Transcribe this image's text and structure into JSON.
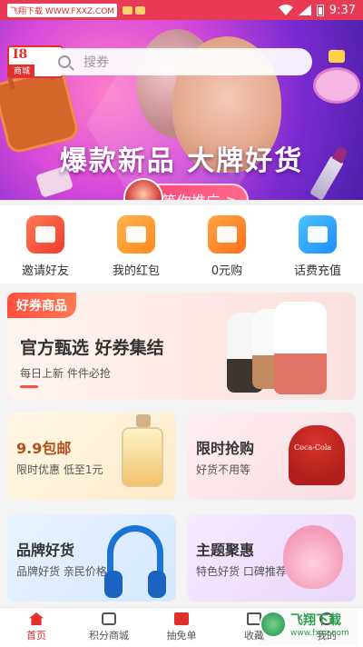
{
  "status_bar": {
    "watermark": "飞翔下载 WWW.FXXZ.COM",
    "time": "9:37"
  },
  "header": {
    "logo_main": "I8",
    "logo_sub": "商城",
    "search_placeholder": "搜券"
  },
  "banner": {
    "headline": "爆款新品 大牌好货",
    "cta_label": "等你推广",
    "cta_arrow": ">"
  },
  "quick_actions": [
    {
      "label": "邀请好友",
      "icon": "invite-icon",
      "color": "#f03a2f"
    },
    {
      "label": "我的红包",
      "icon": "gift-icon",
      "color": "#ff8a1e"
    },
    {
      "label": "0元购",
      "icon": "store-icon",
      "color": "#ff6f1e"
    },
    {
      "label": "话费充值",
      "icon": "phone-topup-icon",
      "color": "#1e8dff"
    }
  ],
  "coupon_section": {
    "tag": "好券商品",
    "title": "官方甄选 好券集结",
    "subtitle": "每日上新 件件必抢"
  },
  "promo_cards": [
    {
      "title": "9.9包邮",
      "subtitle": "限时优惠 低至1元"
    },
    {
      "title": "限时抢购",
      "subtitle": "好货不用等"
    },
    {
      "title": "品牌好货",
      "subtitle": "品牌好货 亲民价格"
    },
    {
      "title": "主题聚惠",
      "subtitle": "特色好货 口碑推荐"
    }
  ],
  "bottom_nav": [
    {
      "label": "首页",
      "icon": "home-icon",
      "active": true
    },
    {
      "label": "积分商城",
      "icon": "store-icon",
      "active": false
    },
    {
      "label": "抽免单",
      "icon": "ticket-icon",
      "active": false
    },
    {
      "label": "收藏",
      "icon": "favorite-icon",
      "active": false
    },
    {
      "label": "我的",
      "icon": "user-icon",
      "active": false
    }
  ],
  "site_watermark": {
    "title": "飞翔下载",
    "url": "www.fxxz.com"
  },
  "colors": {
    "accent": "#e0312d",
    "coupon_tag": "#ff4f3d"
  }
}
